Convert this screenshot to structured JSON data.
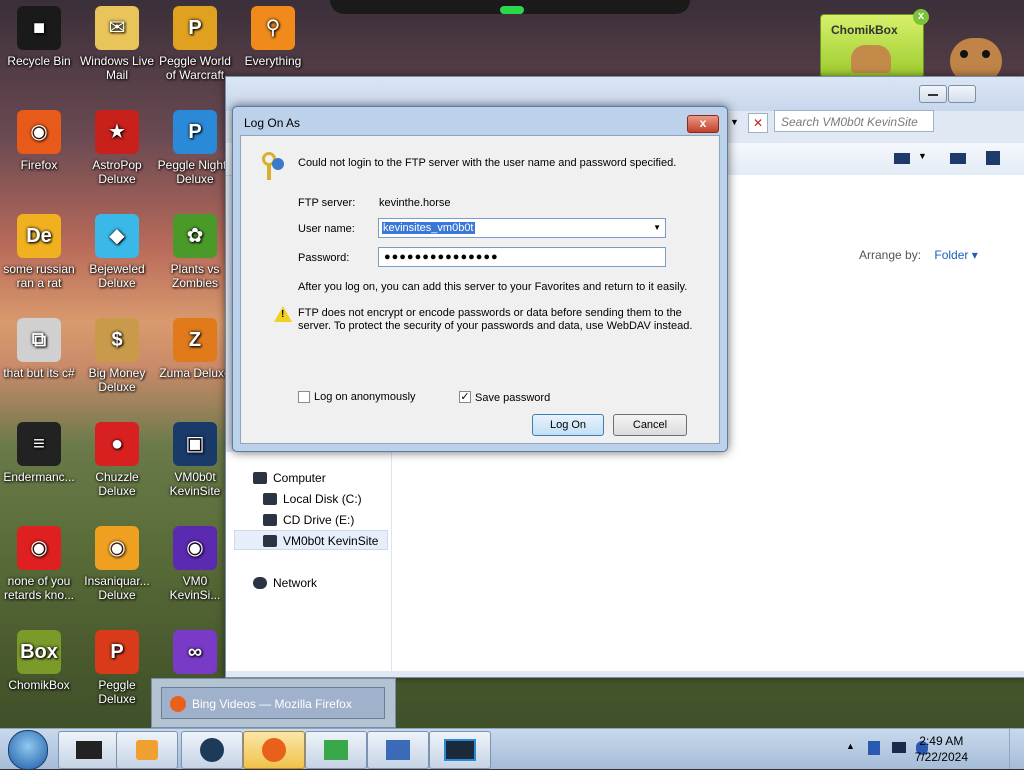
{
  "desktop": {
    "icons": [
      {
        "label": "Recycle Bin",
        "glyph": "■",
        "color": "#1a1a1a"
      },
      {
        "label": "Windows Live Mail",
        "glyph": "✉",
        "color": "#e8c45a"
      },
      {
        "label": "Peggle World of Warcraft",
        "glyph": "P",
        "color": "#e0a020"
      },
      {
        "label": "Everything",
        "glyph": "⚲",
        "color": "#f08a1a"
      },
      {
        "label": "Firefox",
        "glyph": "◉",
        "color": "#e85a1a"
      },
      {
        "label": "AstroPop Deluxe",
        "glyph": "★",
        "color": "#c8201a"
      },
      {
        "label": "Peggle Nights Deluxe",
        "glyph": "P",
        "color": "#2a8ad8"
      },
      {
        "label": "some russian ran a rat",
        "glyph": "De",
        "color": "#f0b020"
      },
      {
        "label": "Bejeweled Deluxe",
        "glyph": "◆",
        "color": "#3ab8e8"
      },
      {
        "label": "Plants vs Zombies",
        "glyph": "✿",
        "color": "#4a9a2a"
      },
      {
        "label": "that but its c#",
        "glyph": "⧉",
        "color": "#d0d0d0"
      },
      {
        "label": "Big Money Deluxe",
        "glyph": "$",
        "color": "#c89a4a"
      },
      {
        "label": "Zuma Deluxe",
        "glyph": "Z",
        "color": "#e07a1a"
      },
      {
        "label": "Endermanc...",
        "glyph": "≡",
        "color": "#222222"
      },
      {
        "label": "Chuzzle Deluxe",
        "glyph": "●",
        "color": "#d82020"
      },
      {
        "label": "VM0b0t KevinSite",
        "glyph": "▣",
        "color": "#1a3a6a"
      },
      {
        "label": "none of you retards kno...",
        "glyph": "◉",
        "color": "#e02020"
      },
      {
        "label": "Insaniquar... Deluxe",
        "glyph": "◉",
        "color": "#f0a020"
      },
      {
        "label": "VM0 KevinSi...",
        "glyph": "◉",
        "color": "#5a2ab0"
      },
      {
        "label": "ChomikBox",
        "glyph": "Box",
        "color": "#7a9a2a"
      },
      {
        "label": "Peggle Deluxe",
        "glyph": "P",
        "color": "#d83a1a"
      },
      {
        "label": "",
        "glyph": "∞",
        "color": "#7a3ac8"
      }
    ]
  },
  "explorer": {
    "search_placeholder": "Search VM0b0t KevinSite",
    "arrange_label": "Arrange by:",
    "arrange_value": "Folder ▾",
    "nav": {
      "computer": "Computer",
      "local_disk": "Local Disk (C:)",
      "cd_drive": "CD Drive (E:)",
      "site": "VM0b0t KevinSite",
      "network": "Network"
    }
  },
  "dialog": {
    "title": "Log On As",
    "close_label": "x",
    "message": "Could not login to the FTP server with the user name and password specified.",
    "ftp_server_label": "FTP server:",
    "ftp_server_value": "kevinthe.horse",
    "username_label": "User name:",
    "username_value": "kevinsites_vm0b0t",
    "password_label": "Password:",
    "password_value": "●●●●●●●●●●●●●●●",
    "info": "After you log on, you can add this server to your Favorites and return to it easily.",
    "warning_line1": "FTP does not encrypt or encode passwords or data before sending them to the",
    "warning_line2": "server.  To protect the security of your passwords and data, use WebDAV instead.",
    "anon_label": "Log on anonymously",
    "anon_checked": false,
    "save_label": "Save password",
    "save_checked": true,
    "logon_label": "Log On",
    "cancel_label": "Cancel"
  },
  "chomikbox": {
    "title": "ChomikBox",
    "close": "x"
  },
  "taskbar": {
    "preview_label": "Bing Videos — Mozilla Firefox",
    "time": "2:49 AM",
    "date": "7/22/2024"
  }
}
